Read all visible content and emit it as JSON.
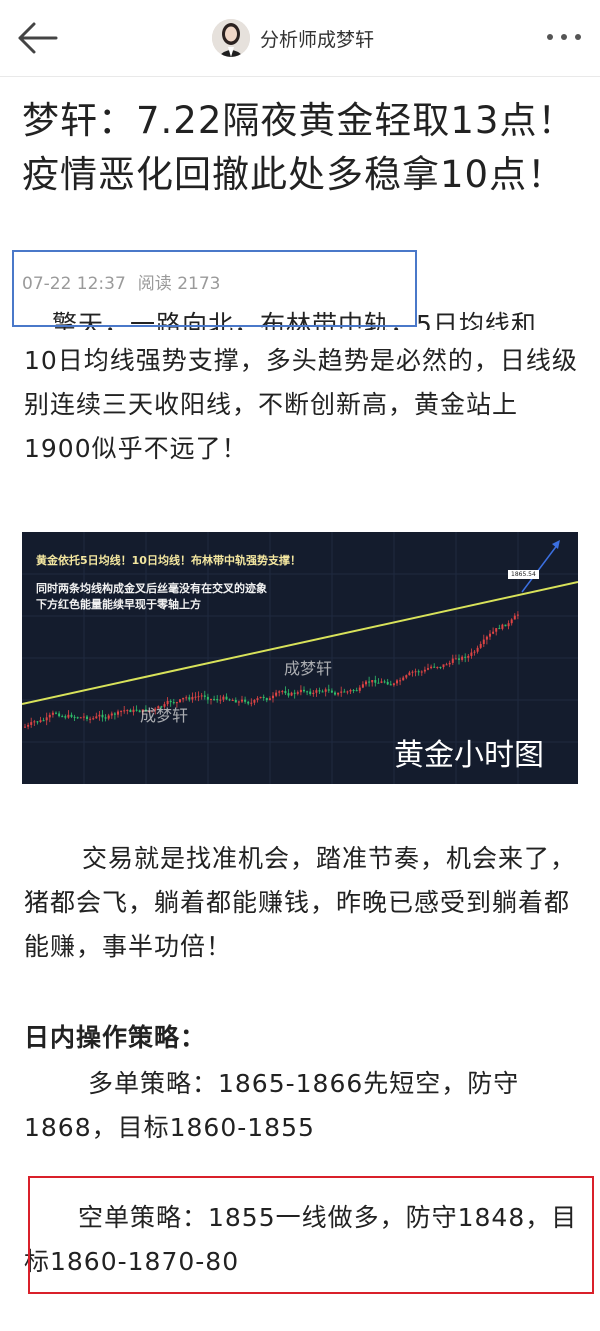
{
  "header": {
    "author_name": "分析师成梦轩"
  },
  "article": {
    "title": "梦轩：7.22隔夜黄金轻取13点！疫情恶化回撤此处多稳拿10点！",
    "date": "07-22 12:37",
    "read_label": "阅读",
    "read_count": "2173",
    "cutoff_line": "擎天，一路向北，布林带中轨，5日均线和",
    "paragraph_1": "10日均线强势支撑，多头趋势是必然的，日线级别连续三天收阳线，不断创新高，黄金站上1900似乎不远了！",
    "paragraph_2": "交易就是找准机会，踏准节奏，机会来了，猪都会飞，躺着都能赚钱，昨晚已感受到躺着都能赚，事半功倍！",
    "section_heading": "日内操作策略：",
    "strategy_long": "多单策略：1865-1866先短空，防守1868，目标1860-1855",
    "strategy_short": "空单策略：1855一线做多，防守1848，目标1860-1870-80"
  },
  "chart_image": {
    "annotation_1": "黄金依托5日均线！10日均线！布林带中轨强势支撑！",
    "annotation_2": "同时两条均线构成金叉后丝毫没有在交叉的迹象",
    "annotation_3": "下方红色能量能续早现于零轴上方",
    "caption": "黄金小时图",
    "watermark": "成梦轩",
    "price_tag": "1865.54"
  },
  "colors": {
    "meta_box_border": "#4a78c9",
    "strategy_box_border": "#d9202a",
    "chart_background": "#141c2d"
  },
  "icons": {
    "back": "back-arrow-icon",
    "more": "more-dots-icon"
  }
}
